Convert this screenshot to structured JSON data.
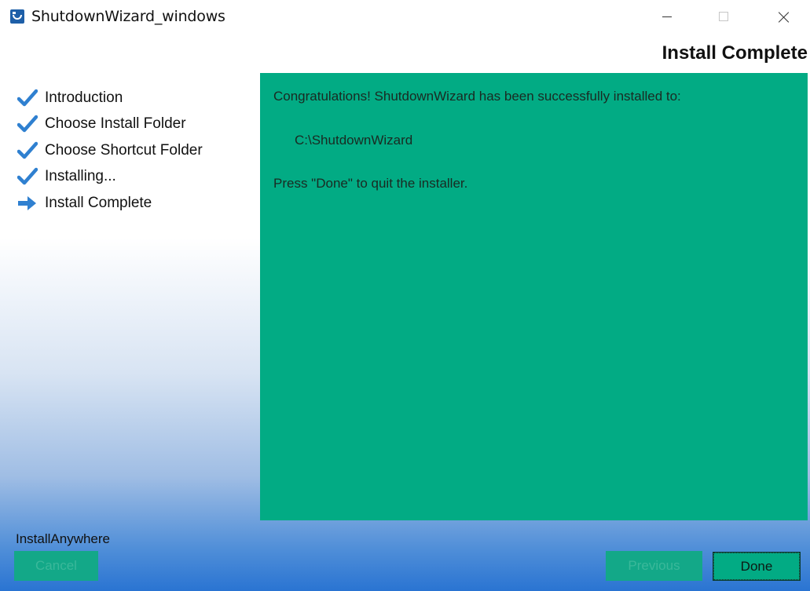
{
  "window": {
    "title": "ShutdownWizard_windows"
  },
  "header": {
    "title": "Install Complete"
  },
  "sidebar": {
    "steps": [
      {
        "label": "Introduction",
        "icon": "check-icon"
      },
      {
        "label": "Choose Install Folder",
        "icon": "check-icon"
      },
      {
        "label": "Choose Shortcut Folder",
        "icon": "check-icon"
      },
      {
        "label": "Installing...",
        "icon": "check-icon"
      },
      {
        "label": "Install Complete",
        "icon": "arrow-right-icon"
      }
    ]
  },
  "content": {
    "line1": "Congratulations! ShutdownWizard has been successfully installed to:",
    "install_path": "C:\\ShutdownWizard",
    "line3": "Press \"Done\" to quit the installer."
  },
  "footer": {
    "brand": "InstallAnywhere",
    "cancel_label": "Cancel",
    "previous_label": "Previous",
    "done_label": "Done"
  },
  "colors": {
    "panel": "#02ab84",
    "check": "#2f80d0",
    "gradient_bottom": "#2a74d2"
  }
}
